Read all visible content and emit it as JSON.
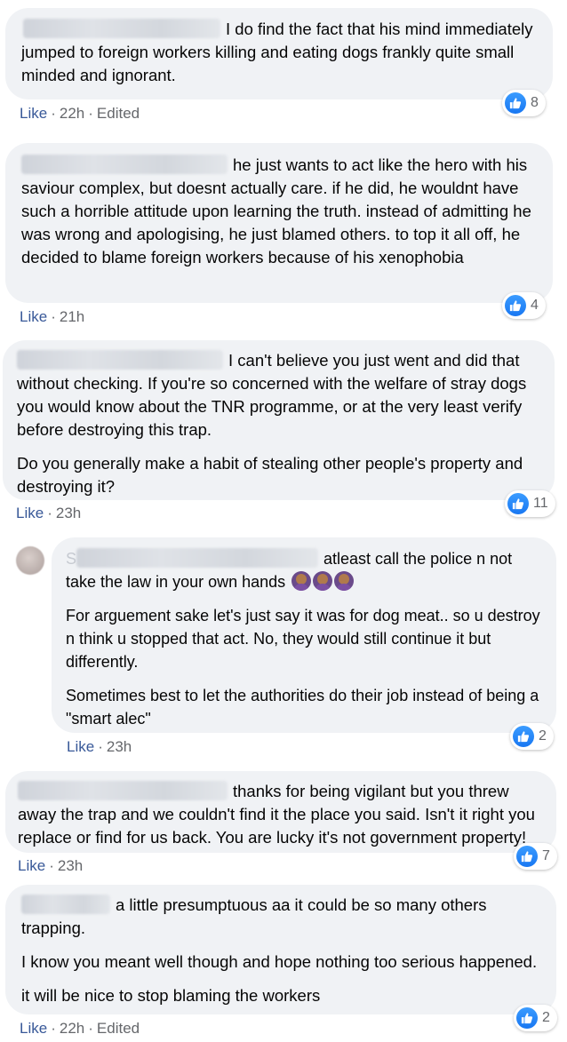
{
  "comments": [
    {
      "paragraphs": [
        "I do find the fact that his mind immediately jumped to foreign workers killing and eating dogs frankly quite small minded and ignorant."
      ],
      "like_label": "Like",
      "time": "22h",
      "edited": "Edited",
      "reactions": "8"
    },
    {
      "paragraphs": [
        "he just wants to act like the hero with his saviour complex, but doesnt actually care. if he did, he wouldnt have such a horrible attitude upon learning the truth. instead of admitting he was wrong and apologising, he just blamed others. to top it all off, he decided to blame foreign workers because of his xenophobia"
      ],
      "like_label": "Like",
      "time": "21h",
      "reactions": "4"
    },
    {
      "paragraphs": [
        "I can't believe you just went and did that without checking. If you're so concerned with the welfare of stray dogs you would know about the TNR programme, or at the very least verify before destroying this trap.",
        "Do you generally make a habit of stealing other people's property and destroying it?"
      ],
      "like_label": "Like",
      "time": "23h",
      "reactions": "11"
    },
    {
      "name_initial": "S",
      "paragraphs": [
        "atleast call the police n not take the law in your own hands",
        "For arguement sake let's just say it was for dog meat.. so u destroy n think u stopped that act. No, they would still continue it but differently.",
        "Sometimes best to let the authorities do their job instead of being a \"smart alec\""
      ],
      "emoji_name": "woman-facepalming-emoji",
      "like_label": "Like",
      "time": "23h",
      "reactions": "2"
    },
    {
      "paragraphs": [
        "thanks for being vigilant but you threw away the trap and we couldn't find it the place you said. Isn't it right you replace or find for us back. You are lucky it's not government property!"
      ],
      "like_label": "Like",
      "time": "23h",
      "reactions": "7"
    },
    {
      "paragraphs": [
        "a little presumptuous aa it could be so many others trapping.",
        "I know you meant well though and hope nothing too serious happened.",
        "it will be nice to stop blaming the workers"
      ],
      "like_label": "Like",
      "time": "22h",
      "edited": "Edited",
      "reactions": "2"
    }
  ],
  "colors": {
    "bubble": "#f0f2f5",
    "like_link": "#385898",
    "meta": "#65676b",
    "like_icon": "#1877f2"
  }
}
